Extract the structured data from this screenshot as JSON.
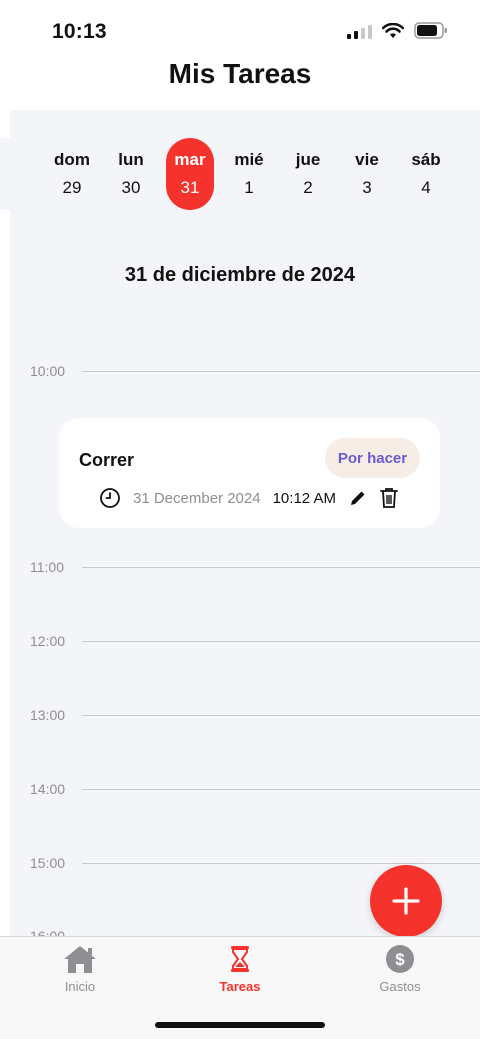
{
  "status_bar": {
    "time": "10:13"
  },
  "header": {
    "title": "Mis Tareas"
  },
  "week": {
    "days": [
      {
        "name": "dom",
        "num": "29"
      },
      {
        "name": "lun",
        "num": "30"
      },
      {
        "name": "mar",
        "num": "31",
        "selected": true
      },
      {
        "name": "mié",
        "num": "1"
      },
      {
        "name": "jue",
        "num": "2"
      },
      {
        "name": "vie",
        "num": "3"
      },
      {
        "name": "sáb",
        "num": "4"
      }
    ]
  },
  "selected_date": "31 de diciembre de 2024",
  "timeline": {
    "hours": [
      "10:00",
      "11:00",
      "12:00",
      "13:00",
      "14:00",
      "15:00",
      "16:00"
    ]
  },
  "task": {
    "title": "Correr",
    "status": "Por hacer",
    "date": "31 December 2024",
    "time": "10:12 AM"
  },
  "tabs": [
    {
      "label": "Inicio",
      "icon": "home-icon"
    },
    {
      "label": "Tareas",
      "icon": "hourglass-icon",
      "active": true
    },
    {
      "label": "Gastos",
      "icon": "dollar-icon"
    }
  ],
  "colors": {
    "accent": "#f5332c",
    "status_text": "#6a5ad6",
    "status_bg": "#f6ede6",
    "background": "#f4f5f9"
  }
}
